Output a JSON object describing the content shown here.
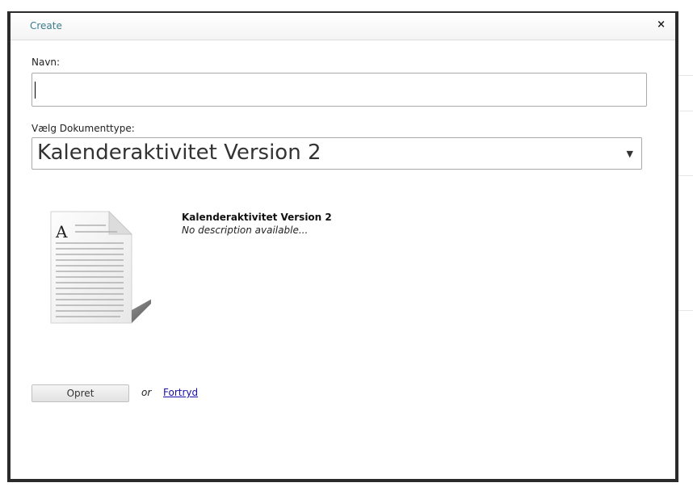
{
  "dialog": {
    "title": "Create",
    "close_glyph": "×",
    "close_icon": "close-icon"
  },
  "form": {
    "name_label": "Navn:",
    "name_value": "",
    "doctype_label": "Vælg Dokumenttype:",
    "doctype_selected": "Kalenderaktivitet Version 2",
    "dropdown_arrow": "▼"
  },
  "document_type": {
    "icon": "document-icon",
    "icon_letter": "A",
    "name": "Kalenderaktivitet Version 2",
    "description": "No description available..."
  },
  "actions": {
    "create_label": "Opret",
    "or_text": "or",
    "cancel_label": "Fortryd"
  },
  "colors": {
    "title_color": "#3a7c8c",
    "link_color": "#1a0dab",
    "border_color": "#2b2b2b"
  }
}
